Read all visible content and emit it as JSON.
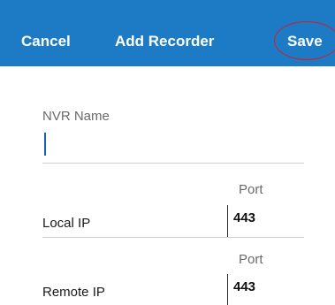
{
  "header": {
    "cancel_label": "Cancel",
    "title": "Add Recorder",
    "save_label": "Save",
    "background_color": "#1d7bc6",
    "highlight_color": "#d11e2b"
  },
  "form": {
    "nvr_name": {
      "label": "NVR Name",
      "value": ""
    },
    "local_ip": {
      "label": "Local IP",
      "port_label": "Port",
      "port_value": "443"
    },
    "remote_ip": {
      "label": "Remote IP",
      "port_label": "Port",
      "port_value": "443"
    }
  }
}
